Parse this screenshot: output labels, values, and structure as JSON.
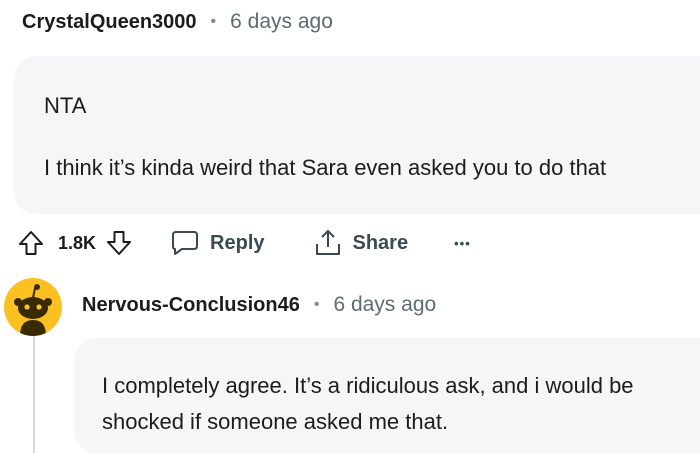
{
  "comment": {
    "author": "CrystalQueen3000",
    "separator": "•",
    "time": "6 days ago",
    "lines": [
      "NTA",
      "I think it’s kinda weird that Sara even asked you to do that"
    ],
    "score": "1.8K",
    "actions": {
      "reply_label": "Reply",
      "share_label": "Share",
      "more_label": "•••"
    }
  },
  "reply": {
    "author": "Nervous-Conclusion46",
    "separator": "•",
    "time": "6 days ago",
    "lines": [
      "I completely agree. It’s a ridiculous ask, and i would be",
      "shocked if someone asked me that."
    ]
  },
  "colors": {
    "bubble": "#f5f6f7",
    "avatar": "#fcc020",
    "muted_text": "#5c6c74"
  },
  "icons": {
    "upvote": "arrow-up-icon",
    "downvote": "arrow-down-icon",
    "reply": "speech-bubble-icon",
    "share": "share-icon",
    "more": "ellipsis-icon",
    "avatar": "snoo-avatar-icon"
  }
}
